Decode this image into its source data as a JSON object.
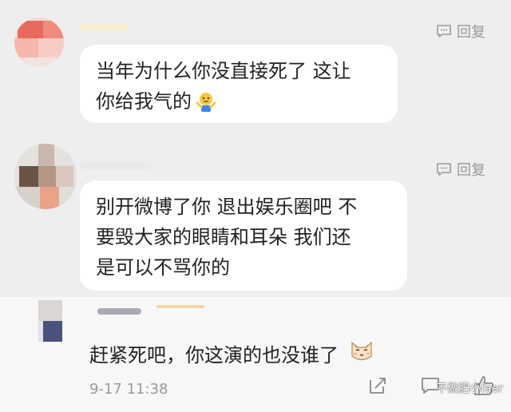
{
  "comments": [
    {
      "reply_label": "回复",
      "text_lines": [
        "当年为什么你没直接死了 这让",
        "你给我气的"
      ],
      "emoji": "shrug-emoji"
    },
    {
      "reply_label": "回复",
      "text_lines": [
        "别开微博了你 退出娱乐圈吧 不",
        "要毁大家的眼睛和耳朵 我们还",
        "是可以不骂你的"
      ]
    },
    {
      "text": "赶紧死吧，你这演的也没谁了",
      "emoji": "cat-face-emoji",
      "timestamp": "9-17 11:38"
    }
  ],
  "watermark": "不做肥小faer",
  "icons": {
    "reply": "comment-bubble-icon",
    "share": "share-icon",
    "comment": "comment-icon",
    "like": "thumbs-up-icon"
  },
  "colors": {
    "page_bg": "#eeeeee",
    "bubble_bg": "#ffffff",
    "meta_text": "#999999",
    "body_text": "#222222"
  }
}
